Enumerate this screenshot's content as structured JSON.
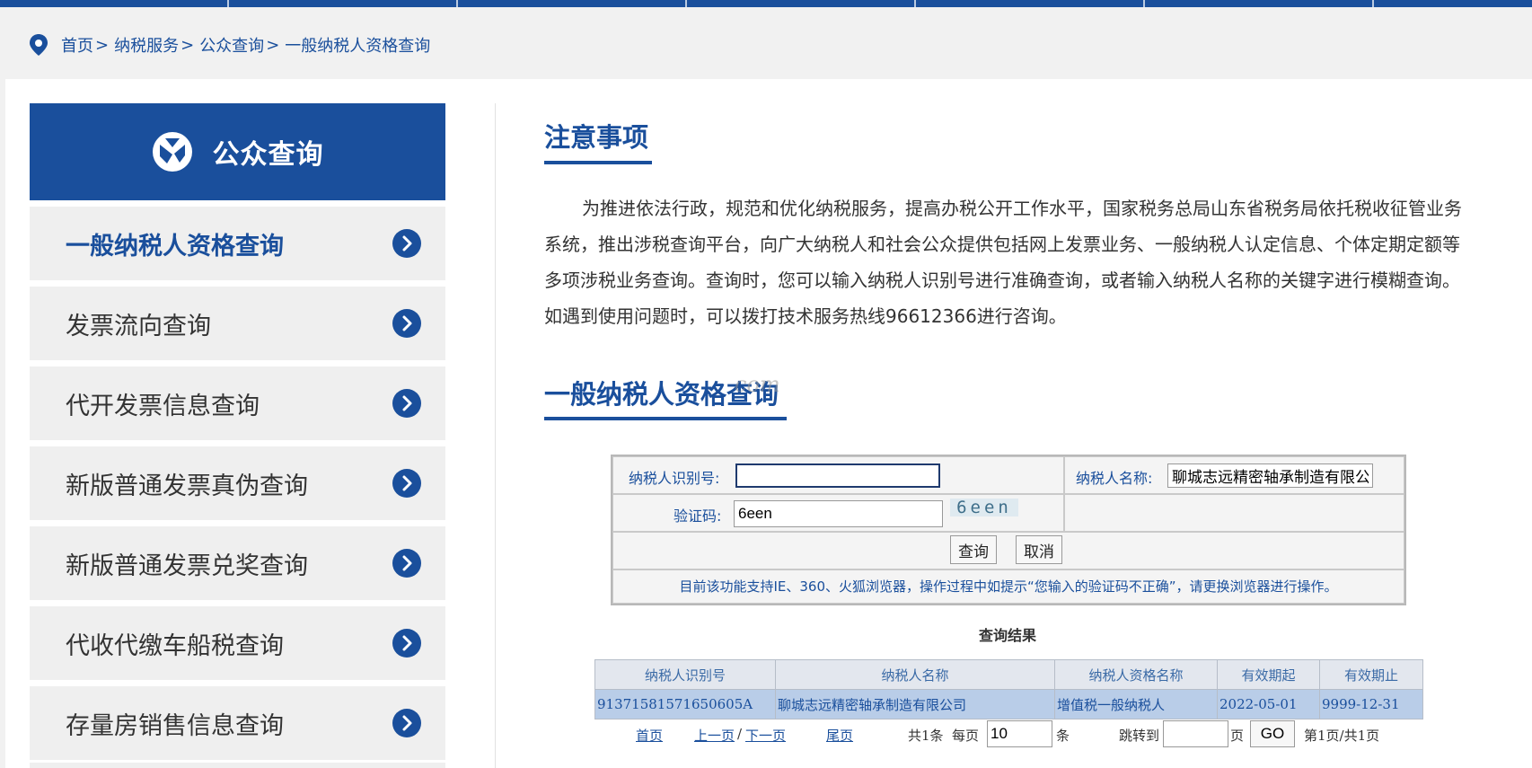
{
  "breadcrumb": {
    "items": [
      "首页",
      "纳税服务",
      "公众查询",
      "一般纳税人资格查询"
    ],
    "separator": ">"
  },
  "sidebar": {
    "title": "公众查询",
    "items": [
      {
        "label": "一般纳税人资格查询",
        "active": true
      },
      {
        "label": "发票流向查询"
      },
      {
        "label": "代开发票信息查询"
      },
      {
        "label": "新版普通发票真伪查询"
      },
      {
        "label": "新版普通发票兑奖查询"
      },
      {
        "label": "代收代缴车船税查询"
      },
      {
        "label": "存量房销售信息查询"
      }
    ]
  },
  "notice": {
    "title": "注意事项",
    "text": "为推进依法行政，规范和优化纳税服务，提高办税公开工作水平，国家税务总局山东省税务局依托税收征管业务系统，推出涉税查询平台，向广大纳税人和社会公众提供包括网上发票业务、一般纳税人认定信息、个体定期定额等多项涉税业务查询。查询时，您可以输入纳税人识别号进行准确查询，或者输入纳税人名称的关键字进行模糊查询。如遇到使用问题时，可以拨打技术服务热线96612366进行咨询。"
  },
  "query": {
    "title": "一般纳税人资格查询",
    "watermark": "com",
    "taxpayer_id_label": "纳税人识别号:",
    "taxpayer_id_value": "",
    "taxpayer_name_label": "纳税人名称:",
    "taxpayer_name_value": "聊城志远精密轴承制造有限公司",
    "captcha_label": "验证码:",
    "captcha_value": "6een",
    "captcha_image_text": "6een",
    "search_button": "查询",
    "cancel_button": "取消",
    "hint": "目前该功能支持IE、360、火狐浏览器，操作过程中如提示“您输入的验证码不正确”，请更换浏览器进行操作。"
  },
  "results": {
    "caption": "查询结果",
    "columns": [
      "纳税人识别号",
      "纳税人名称",
      "纳税人资格名称",
      "有效期起",
      "有效期止"
    ],
    "rows": [
      [
        "91371581571650605A",
        "聊城志远精密轴承制造有限公司",
        "增值税一般纳税人",
        "2022-05-01",
        "9999-12-31"
      ]
    ]
  },
  "pager": {
    "first": "首页",
    "prev": "上一页",
    "slash": "/",
    "next": "下一页",
    "last": "尾页",
    "total": "共1条",
    "per_page_label": "每页",
    "per_page_value": "10",
    "per_page_unit": "条",
    "jump_label": "跳转到",
    "jump_value": "",
    "page_unit": "页",
    "go_button": "GO",
    "status": "第1页/共1页"
  },
  "colors": {
    "brand_blue": "#1a4f9c",
    "row_highlight": "#b9cde8",
    "header_bg": "#e3e7ee"
  }
}
